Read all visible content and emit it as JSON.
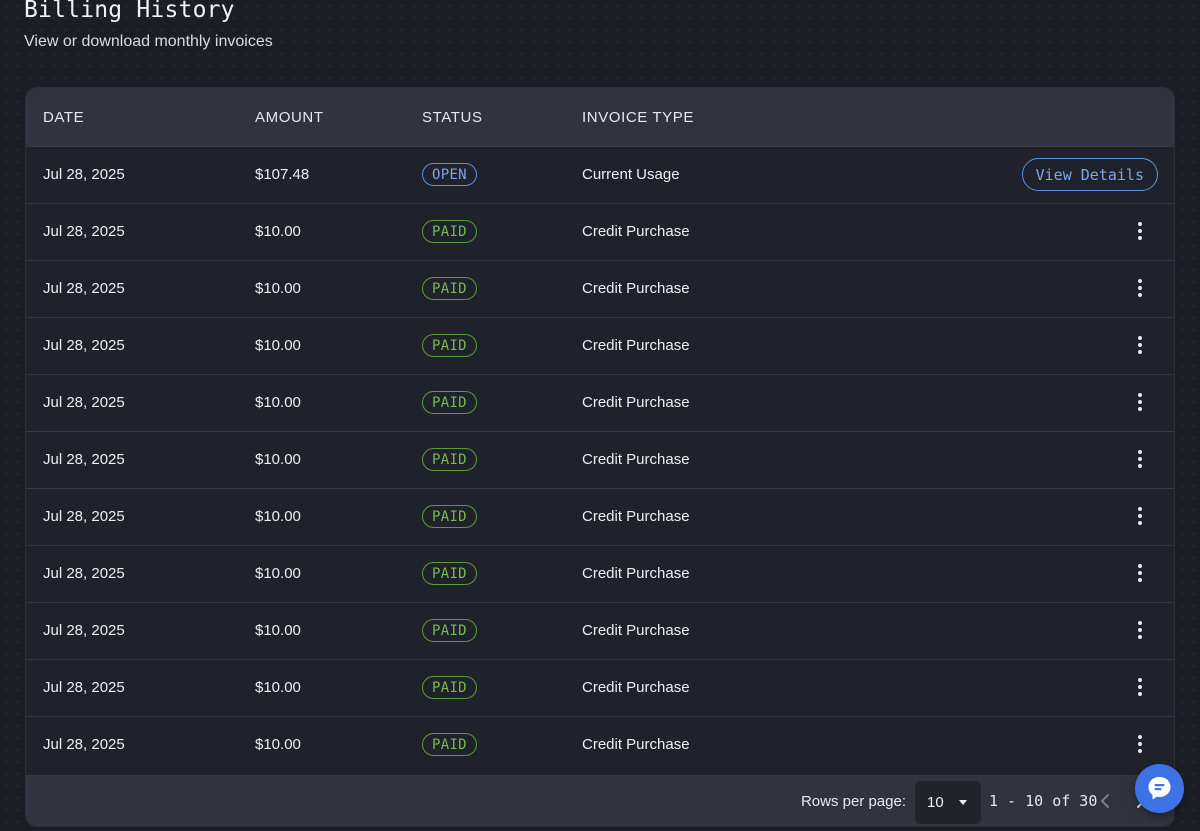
{
  "header": {
    "title": "Billing History",
    "subtitle": "View or download monthly invoices"
  },
  "table": {
    "columns": [
      "DATE",
      "AMOUNT",
      "STATUS",
      "INVOICE TYPE"
    ],
    "rows": [
      {
        "date": "Jul 28, 2025",
        "amount": "$107.48",
        "status": "OPEN",
        "type": "Current Usage",
        "action": "View Details"
      },
      {
        "date": "Jul 28, 2025",
        "amount": "$10.00",
        "status": "PAID",
        "type": "Credit Purchase"
      },
      {
        "date": "Jul 28, 2025",
        "amount": "$10.00",
        "status": "PAID",
        "type": "Credit Purchase"
      },
      {
        "date": "Jul 28, 2025",
        "amount": "$10.00",
        "status": "PAID",
        "type": "Credit Purchase"
      },
      {
        "date": "Jul 28, 2025",
        "amount": "$10.00",
        "status": "PAID",
        "type": "Credit Purchase"
      },
      {
        "date": "Jul 28, 2025",
        "amount": "$10.00",
        "status": "PAID",
        "type": "Credit Purchase"
      },
      {
        "date": "Jul 28, 2025",
        "amount": "$10.00",
        "status": "PAID",
        "type": "Credit Purchase"
      },
      {
        "date": "Jul 28, 2025",
        "amount": "$10.00",
        "status": "PAID",
        "type": "Credit Purchase"
      },
      {
        "date": "Jul 28, 2025",
        "amount": "$10.00",
        "status": "PAID",
        "type": "Credit Purchase"
      },
      {
        "date": "Jul 28, 2025",
        "amount": "$10.00",
        "status": "PAID",
        "type": "Credit Purchase"
      },
      {
        "date": "Jul 28, 2025",
        "amount": "$10.00",
        "status": "PAID",
        "type": "Credit Purchase"
      }
    ]
  },
  "pagination": {
    "rows_per_page_label": "Rows per page:",
    "rows_per_page_value": "10",
    "range_text": "1 - 10 of 30"
  },
  "icons": {
    "row_menu": "more-vertical-icon",
    "select_caret": "caret-down-icon",
    "prev": "chevron-left-icon",
    "next": "chevron-right-icon",
    "chat": "chat-bubble-icon"
  },
  "colors": {
    "open_badge": "#5c8fe0",
    "paid_badge": "#5b9a3a",
    "accent": "#3d73e6"
  }
}
